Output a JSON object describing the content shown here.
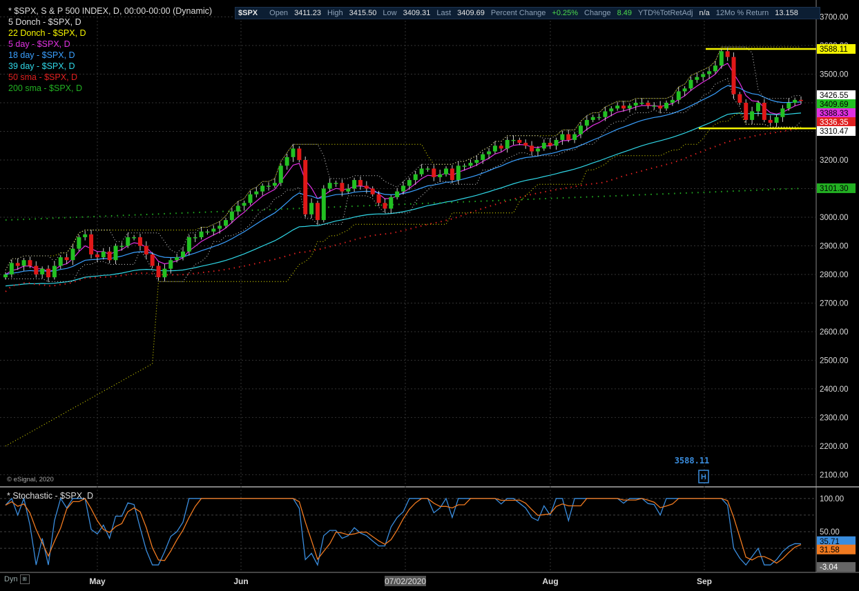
{
  "legend": [
    {
      "label": "* $SPX, S & P 500 INDEX, D, 00:00-00:00 (Dynamic)",
      "color": "#dddddd"
    },
    {
      "label": "5 Donch - $SPX, D",
      "color": "#e0e0e0"
    },
    {
      "label": "22 Donch - $SPX, D",
      "color": "#f5f500"
    },
    {
      "label": "5 day - $SPX, D",
      "color": "#e030e0"
    },
    {
      "label": "18 day - $SPX, D",
      "color": "#3aa0ff"
    },
    {
      "label": "39 day - $SPX, D",
      "color": "#30d8e8"
    },
    {
      "label": "50 sma - $SPX, D",
      "color": "#e02020"
    },
    {
      "label": "200 sma - $SPX, D",
      "color": "#22b022"
    }
  ],
  "quote": {
    "symbol": "$SPX",
    "open_label": "Open",
    "open": "3411.23",
    "high_label": "High",
    "high": "3415.50",
    "low_label": "Low",
    "low": "3409.31",
    "last_label": "Last",
    "last": "3409.69",
    "pct_label": "Percent Change",
    "pct": "+0.25%",
    "chg_label": "Change",
    "chg": "8.49",
    "ytd_label": "YTD%TotRetAdj",
    "ytd": "n/a",
    "m12_label": "12Mo % Return",
    "m12": "13.158"
  },
  "stoch_title": "* Stochastic - $SPX, D",
  "copyright": "© eSignal, 2020",
  "dyn_label": "Dyn",
  "marker_label": "3588.11",
  "marker_letter": "H",
  "chart_data": {
    "type": "candlestick",
    "x_labels": [
      "May",
      "Jun",
      "07/02/2020",
      "Aug",
      "Sep"
    ],
    "y_ticks": [
      2100,
      2200,
      2300,
      2400,
      2500,
      2600,
      2700,
      2800,
      2900,
      3000,
      3100,
      3200,
      3300,
      3400,
      3500,
      3600,
      3700
    ],
    "y_tick_labels": [
      "2100.00",
      "2200.00",
      "2300.00",
      "2400.00",
      "2500.00",
      "2600.00",
      "2700.00",
      "2800.00",
      "2900.00",
      "3000.00",
      "3100.00",
      "3200.00",
      "3300.00",
      "3400.00",
      "3500.00",
      "3600.00",
      "3700.00"
    ],
    "ylim": [
      2060,
      3735
    ],
    "closes": [
      2800,
      2840,
      2830,
      2850,
      2830,
      2800,
      2820,
      2790,
      2830,
      2860,
      2850,
      2890,
      2930,
      2940,
      2870,
      2860,
      2880,
      2850,
      2900,
      2900,
      2930,
      2930,
      2900,
      2870,
      2830,
      2790,
      2820,
      2850,
      2860,
      2880,
      2930,
      2930,
      2950,
      2950,
      2960,
      2970,
      2990,
      3020,
      3040,
      3050,
      3080,
      3090,
      3110,
      3110,
      3120,
      3180,
      3210,
      3240,
      3200,
      3010,
      3050,
      2990,
      3100,
      3120,
      3120,
      3090,
      3100,
      3130,
      3110,
      3100,
      3080,
      3050,
      3030,
      3070,
      3090,
      3110,
      3130,
      3150,
      3170,
      3170,
      3140,
      3150,
      3170,
      3130,
      3180,
      3180,
      3190,
      3200,
      3220,
      3230,
      3250,
      3240,
      3270,
      3270,
      3260,
      3250,
      3230,
      3240,
      3260,
      3250,
      3270,
      3290,
      3270,
      3290,
      3320,
      3340,
      3350,
      3350,
      3370,
      3380,
      3390,
      3380,
      3390,
      3400,
      3400,
      3390,
      3390,
      3380,
      3400,
      3410,
      3440,
      3450,
      3480,
      3490,
      3500,
      3510,
      3530,
      3580,
      3560,
      3430,
      3400,
      3340,
      3370,
      3400,
      3340,
      3330,
      3350,
      3380,
      3400,
      3410,
      3409.69
    ],
    "price_labels": [
      {
        "value": 3588.11,
        "text": "3588.11",
        "bg": "#f5f500",
        "fg": "#000000"
      },
      {
        "value": 3426.55,
        "text": "3426.55",
        "bg": "#ffffff",
        "fg": "#000000"
      },
      {
        "value": 3409.69,
        "text": "3409.69",
        "bg": "#22c022",
        "fg": "#000000"
      },
      {
        "value": 3388.33,
        "text": "3388.33",
        "bg": "#e030e0",
        "fg": "#000000"
      },
      {
        "value": 3336.35,
        "text": "3336.35",
        "bg": "#e02020",
        "fg": "#ffffff"
      },
      {
        "value": 3310.47,
        "text": "3310.47",
        "bg": "#ffffff",
        "fg": "#000000"
      },
      {
        "value": 3101.3,
        "text": "3101.30",
        "bg": "#22b022",
        "fg": "#000000"
      }
    ],
    "hlines": [
      3588.11,
      3310.47
    ],
    "stochastic": {
      "y_tick_labels": [
        "100.00",
        "50.00"
      ],
      "ylim": [
        -5,
        105
      ],
      "k_label": "35.71",
      "d_label": "31.58",
      "min_label": "-3.04"
    }
  }
}
